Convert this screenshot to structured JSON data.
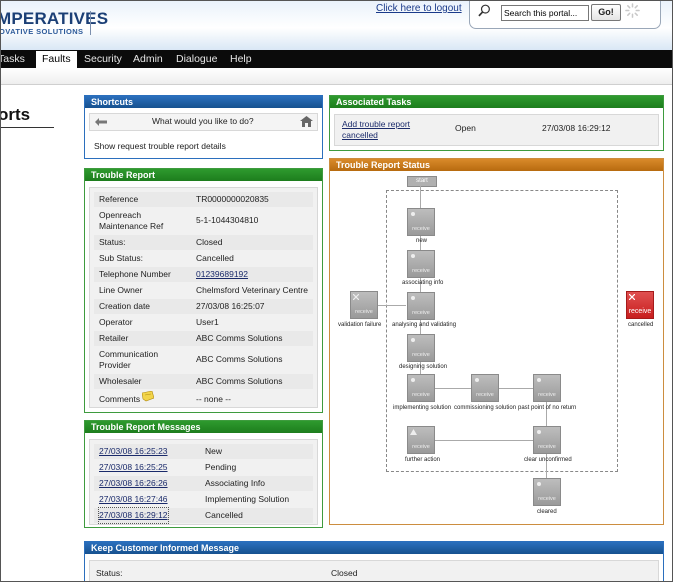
{
  "header": {
    "logo_main": "MPERATIVES",
    "logo_sub": "OVATIVE SOLUTIONS",
    "logout": "Click here to logout",
    "search_placeholder": "Search this portal...",
    "go": "Go!"
  },
  "nav": [
    "Tasks",
    "Faults",
    "Security",
    "Admin",
    "Dialogue",
    "Help"
  ],
  "page_title": "orts",
  "shortcuts": {
    "title": "Shortcuts",
    "prompt": "What would you like to do?",
    "link": "Show request trouble report details"
  },
  "trouble_report": {
    "title": "Trouble Report",
    "rows": [
      {
        "label": "Reference",
        "value": "TR0000000020835"
      },
      {
        "label": "Openreach Maintenance Ref",
        "value": "5-1-1044304810"
      },
      {
        "label": "Status:",
        "value": "Closed"
      },
      {
        "label": "Sub Status:",
        "value": "Cancelled"
      },
      {
        "label": "Telephone Number",
        "value": "01239689192"
      },
      {
        "label": "Line Owner",
        "value": "Chelmsford Veterinary Centre"
      },
      {
        "label": "Creation date",
        "value": "27/03/08 16:25:07"
      },
      {
        "label": "Operator",
        "value": "User1"
      },
      {
        "label": "Retailer",
        "value": "ABC Comms Solutions"
      },
      {
        "label": "Communication Provider",
        "value": "ABC Comms Solutions"
      },
      {
        "label": "Wholesaler",
        "value": "ABC Comms Solutions"
      },
      {
        "label": "Comments",
        "value": "-- none --"
      }
    ]
  },
  "messages": {
    "title": "Trouble Report Messages",
    "rows": [
      {
        "time": "27/03/08 16:25:23",
        "text": "New"
      },
      {
        "time": "27/03/08 16:25:25",
        "text": "Pending"
      },
      {
        "time": "27/03/08 16:26:26",
        "text": "Associating Info"
      },
      {
        "time": "27/03/08 16:27:46",
        "text": "Implementing Solution"
      },
      {
        "time": "27/03/08 16:29:12",
        "text": "Cancelled"
      }
    ]
  },
  "associated_tasks": {
    "title": "Associated Tasks",
    "task": "Add trouble report cancelled",
    "status": "Open",
    "date": "27/03/08 16:29:12"
  },
  "status_diagram": {
    "title": "Trouble Report Status",
    "start": "start",
    "node_text": "receive",
    "labels": {
      "new": "new",
      "associating": "associating info",
      "analysing": "analysing and validating",
      "designing": "designing solution",
      "implementing": "implementing solution",
      "commissioning": "commissioning solution",
      "past_point": "past point of no return",
      "further": "further action",
      "clear_unconfirmed": "clear unconfirmed",
      "cleared": "cleared",
      "validation_failure": "validation failure",
      "cancelled": "cancelled"
    }
  },
  "keep_informed": {
    "title": "Keep Customer Informed Message",
    "label": "Status:",
    "value": "Closed"
  }
}
